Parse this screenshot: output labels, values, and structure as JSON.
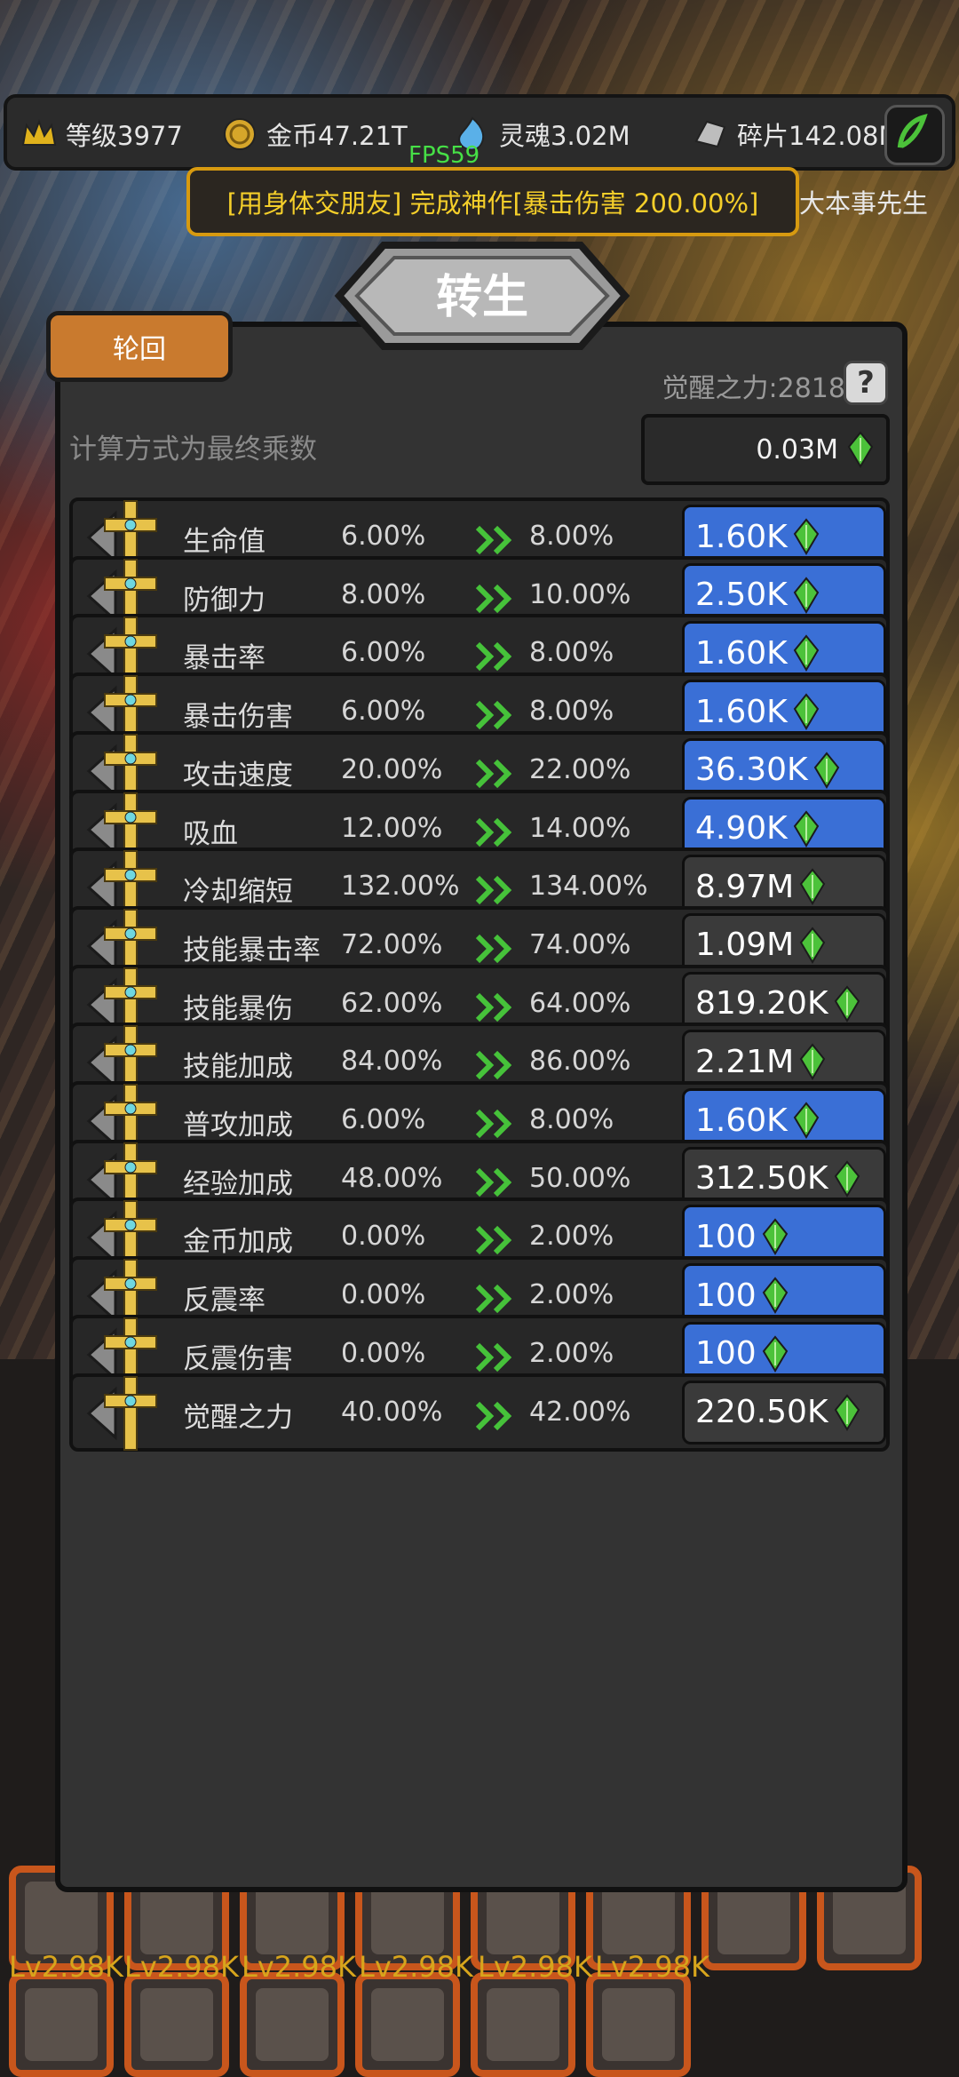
{
  "resources": [
    {
      "icon": "crown-icon",
      "label": "等级3977"
    },
    {
      "icon": "coin-icon",
      "label": "金币47.21T"
    },
    {
      "icon": "soul-icon",
      "label": "灵魂3.02M"
    },
    {
      "icon": "shard-icon",
      "label": "碎片142.08M"
    }
  ],
  "fps": "FPS59",
  "banner": "[用身体交朋友] 完成神作[暴击伤害 200.00%]",
  "right_label": "大本事先生",
  "dialog": {
    "title": "转生",
    "tab": "轮回",
    "awaken_power": "觉醒之力:2818",
    "help": "?",
    "calc_note": "计算方式为最终乘数",
    "total": "0.03M"
  },
  "stats": [
    {
      "name": "生命值",
      "current": "6.00%",
      "next": "8.00%",
      "cost": "1.60K",
      "style": "blue"
    },
    {
      "name": "防御力",
      "current": "8.00%",
      "next": "10.00%",
      "cost": "2.50K",
      "style": "blue"
    },
    {
      "name": "暴击率",
      "current": "6.00%",
      "next": "8.00%",
      "cost": "1.60K",
      "style": "blue"
    },
    {
      "name": "暴击伤害",
      "current": "6.00%",
      "next": "8.00%",
      "cost": "1.60K",
      "style": "blue"
    },
    {
      "name": "攻击速度",
      "current": "20.00%",
      "next": "22.00%",
      "cost": "36.30K",
      "style": "blue"
    },
    {
      "name": "吸血",
      "current": "12.00%",
      "next": "14.00%",
      "cost": "4.90K",
      "style": "blue"
    },
    {
      "name": "冷却缩短",
      "current": "132.00%",
      "next": "134.00%",
      "cost": "8.97M",
      "style": "gray"
    },
    {
      "name": "技能暴击率",
      "current": "72.00%",
      "next": "74.00%",
      "cost": "1.09M",
      "style": "gray"
    },
    {
      "name": "技能暴伤",
      "current": "62.00%",
      "next": "64.00%",
      "cost": "819.20K",
      "style": "gray"
    },
    {
      "name": "技能加成",
      "current": "84.00%",
      "next": "86.00%",
      "cost": "2.21M",
      "style": "gray"
    },
    {
      "name": "普攻加成",
      "current": "6.00%",
      "next": "8.00%",
      "cost": "1.60K",
      "style": "blue"
    },
    {
      "name": "经验加成",
      "current": "48.00%",
      "next": "50.00%",
      "cost": "312.50K",
      "style": "gray"
    },
    {
      "name": "金币加成",
      "current": "0.00%",
      "next": "2.00%",
      "cost": "100",
      "style": "blue"
    },
    {
      "name": "反震率",
      "current": "0.00%",
      "next": "2.00%",
      "cost": "100",
      "style": "blue"
    },
    {
      "name": "反震伤害",
      "current": "0.00%",
      "next": "2.00%",
      "cost": "100",
      "style": "blue"
    },
    {
      "name": "觉醒之力",
      "current": "40.00%",
      "next": "42.00%",
      "cost": "220.50K",
      "style": "gray"
    }
  ],
  "bottom_levels": [
    "Lv2.98K",
    "Lv2.98K",
    "Lv2.98K",
    "Lv2.98K",
    "Lv2.98K",
    "Lv2.98K"
  ],
  "colors": {
    "blue_button": "#3a6fd6",
    "gray_button": "#3a3a3a",
    "gem": "#4cc23a",
    "tab": "#c97a2e"
  }
}
